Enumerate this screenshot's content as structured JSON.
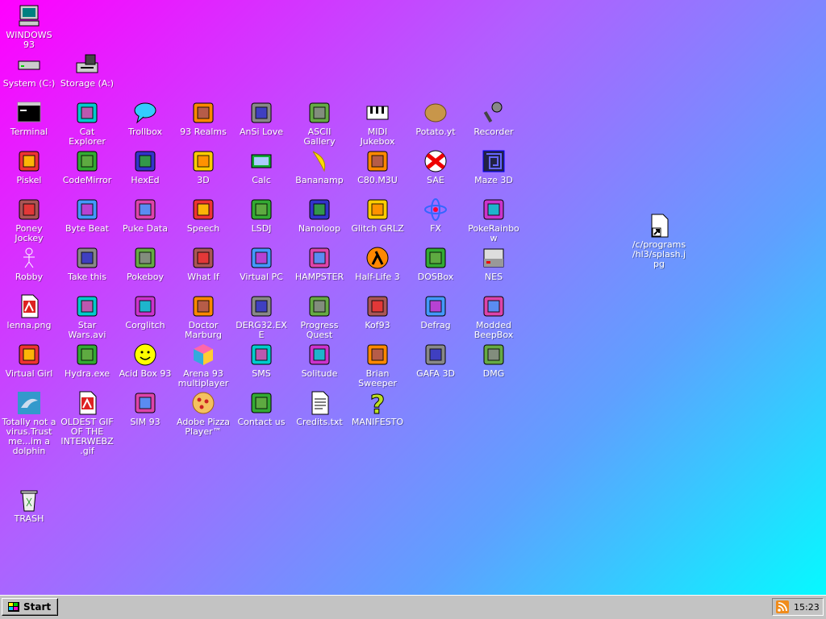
{
  "desktop": {
    "icons": [
      {
        "label": "WINDOWS 93",
        "icon": "computer-icon"
      },
      {
        "label": "System (C:)",
        "icon": "hard-drive-icon"
      },
      {
        "label": "Storage (A:)",
        "icon": "floppy-drive-icon"
      },
      {
        "label": "Terminal",
        "icon": "terminal-icon"
      },
      {
        "label": "Cat Explorer",
        "icon": "cat-explorer-icon"
      },
      {
        "label": "Trollbox",
        "icon": "chat-icon"
      },
      {
        "label": "93 Realms",
        "icon": "realms-icon"
      },
      {
        "label": "AnSi Love",
        "icon": "ansi-icon"
      },
      {
        "label": "ASCII Gallery",
        "icon": "ascii-icon"
      },
      {
        "label": "MIDI Jukebox",
        "icon": "piano-icon"
      },
      {
        "label": "Potato.yt",
        "icon": "potato-icon"
      },
      {
        "label": "Recorder",
        "icon": "microphone-icon"
      },
      {
        "label": "Piskel",
        "icon": "palette-icon"
      },
      {
        "label": "CodeMirror",
        "icon": "codemirror-icon"
      },
      {
        "label": "HexEd",
        "icon": "hex-icon"
      },
      {
        "label": "3D",
        "icon": "teapot-icon"
      },
      {
        "label": "Calc",
        "icon": "calculator-icon"
      },
      {
        "label": "Bananamp",
        "icon": "banana-icon"
      },
      {
        "label": "C80.M3U",
        "icon": "playlist-icon"
      },
      {
        "label": "SAE",
        "icon": "ball-icon"
      },
      {
        "label": "Maze 3D",
        "icon": "maze-icon"
      },
      {
        "label": "Poney Jockey",
        "icon": "pony-icon"
      },
      {
        "label": "Byte Beat",
        "icon": "bytebeat-icon"
      },
      {
        "label": "Puke Data",
        "icon": "pd-icon"
      },
      {
        "label": "Speech",
        "icon": "speech-face-icon"
      },
      {
        "label": "LSDJ",
        "icon": "lsdj-icon"
      },
      {
        "label": "Nanoloop",
        "icon": "nanoloop-icon"
      },
      {
        "label": "Glitch GRLZ",
        "icon": "lips-icon"
      },
      {
        "label": "FX",
        "icon": "atom-icon"
      },
      {
        "label": "PokeRainbow",
        "icon": "pokerainbow-icon"
      },
      {
        "label": "Robby",
        "icon": "stickman-icon"
      },
      {
        "label": "Take this",
        "icon": "takethis-icon"
      },
      {
        "label": "Pokeboy",
        "icon": "pokeboy-icon"
      },
      {
        "label": "What If",
        "icon": "whatif-icon"
      },
      {
        "label": "Virtual PC",
        "icon": "virtualpc-icon"
      },
      {
        "label": "HAMPSTER",
        "icon": "hamster-icon"
      },
      {
        "label": "Half-Life 3",
        "icon": "lambda-icon"
      },
      {
        "label": "DOSBox",
        "icon": "dosbox-icon"
      },
      {
        "label": "NES",
        "icon": "nes-icon"
      },
      {
        "label": "lenna.png",
        "icon": "image-file-icon"
      },
      {
        "label": "Star Wars.avi",
        "icon": "yoda-icon"
      },
      {
        "label": "Corglitch",
        "icon": "corgi-icon"
      },
      {
        "label": "Doctor Marburg",
        "icon": "doctor-icon"
      },
      {
        "label": "DERG32.EXE",
        "icon": "derg-icon"
      },
      {
        "label": "Progress Quest",
        "icon": "swords-icon"
      },
      {
        "label": "Kof93",
        "icon": "fighter-icon"
      },
      {
        "label": "Defrag",
        "icon": "defrag-icon"
      },
      {
        "label": "Modded BeepBox",
        "icon": "beepbox-icon"
      },
      {
        "label": "Virtual Girl",
        "icon": "girl-icon"
      },
      {
        "label": "Hydra.exe",
        "icon": "hydra-icon"
      },
      {
        "label": "Acid Box 93",
        "icon": "smiley-icon"
      },
      {
        "label": "Arena 93 multiplayer",
        "icon": "cube-icon"
      },
      {
        "label": "SMS",
        "icon": "sms-icon"
      },
      {
        "label": "Solitude",
        "icon": "solitude-icon"
      },
      {
        "label": "Brian Sweeper",
        "icon": "mine-icon"
      },
      {
        "label": "GAFA 3D",
        "icon": "doomguy-icon"
      },
      {
        "label": "DMG",
        "icon": "dmg-icon"
      },
      {
        "label": "Totally not a virus.Trust me...im a dolphin",
        "icon": "dolphin-icon"
      },
      {
        "label": "OLDEST GIF OF THE INTERWEBZ.gif",
        "icon": "gif-file-icon"
      },
      {
        "label": "SIM 93",
        "icon": "sim-icon"
      },
      {
        "label": "Adobe Pizza Player™",
        "icon": "pizza-icon"
      },
      {
        "label": "Contact us",
        "icon": "contact-icon"
      },
      {
        "label": "Credits.txt",
        "icon": "text-file-icon"
      },
      {
        "label": "MANIFESTO",
        "icon": "question-icon"
      },
      {
        "label": "TRASH",
        "icon": "trash-icon"
      },
      {
        "label": "/c/programs/hl3/splash.jpg",
        "icon": "shortcut-file-icon"
      }
    ]
  },
  "taskbar": {
    "start_label": "Start",
    "clock": "15:23",
    "tray_icon": "rss-icon"
  },
  "colors": {
    "gradient_start": "#ff00ff",
    "gradient_end": "#00ffff",
    "taskbar": "#c3c3c3"
  }
}
